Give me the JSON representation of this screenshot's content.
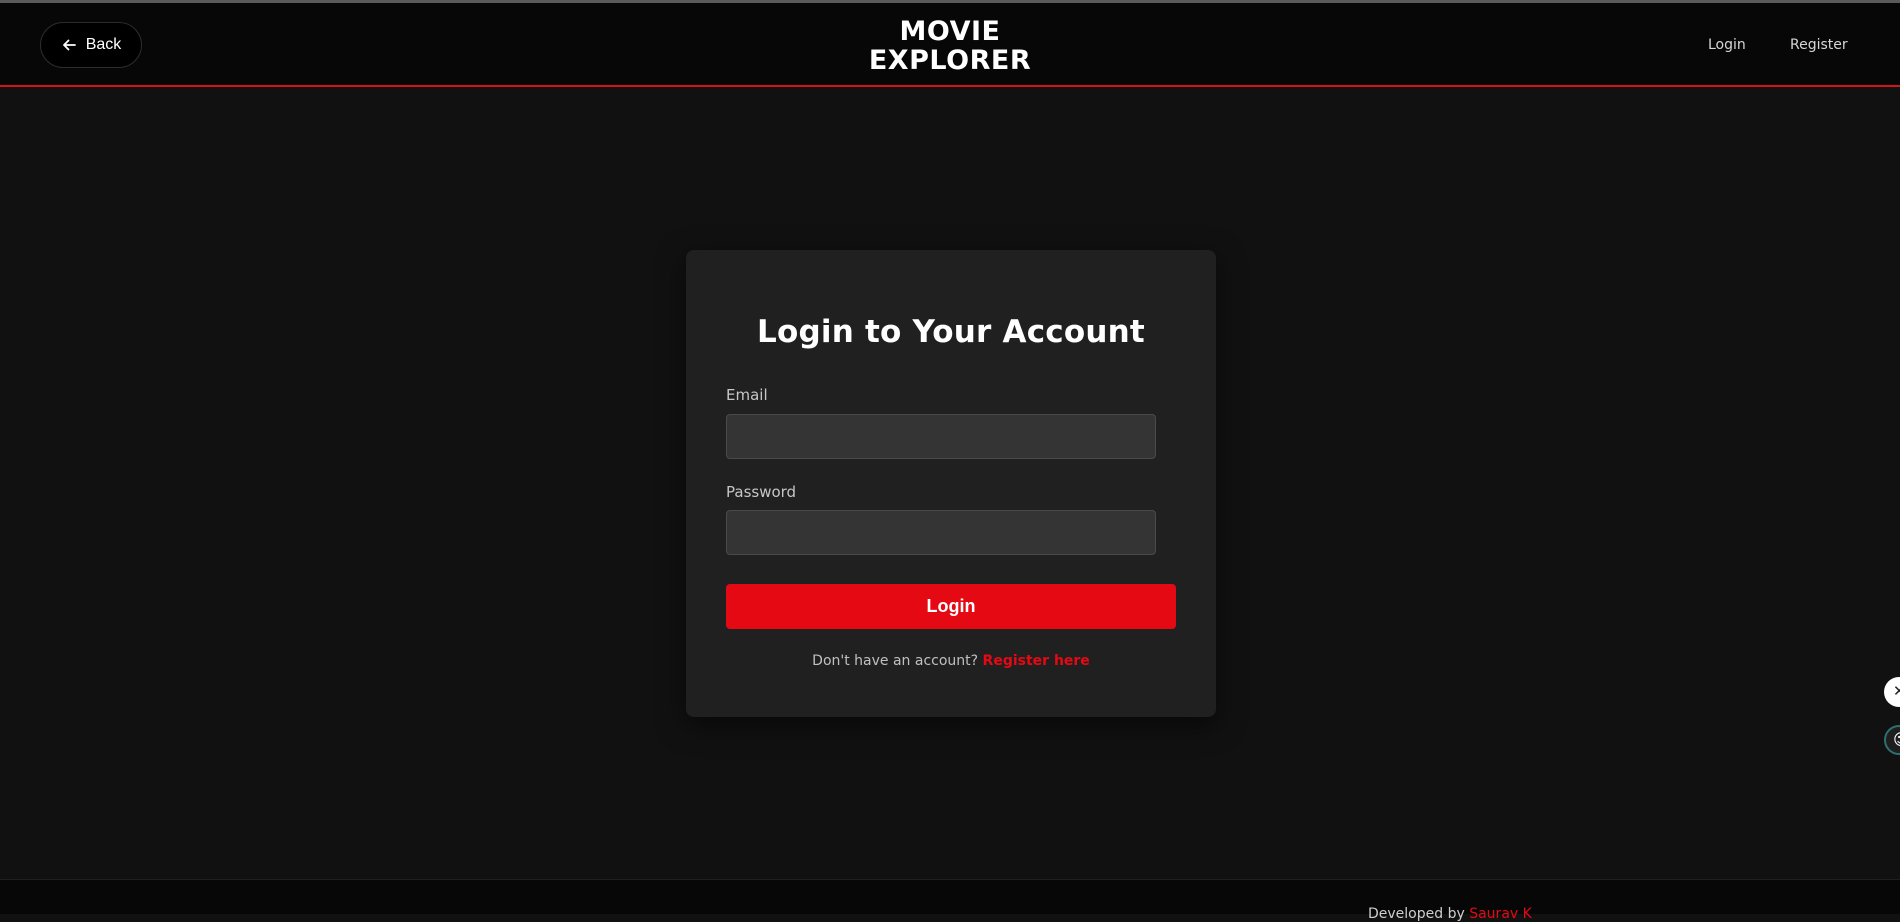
{
  "header": {
    "back_label": "Back",
    "logo_line1": "MOVIE",
    "logo_line2": "EXPLORER",
    "nav": {
      "login": "Login",
      "register": "Register"
    }
  },
  "login_form": {
    "title": "Login to Your Account",
    "email_label": "Email",
    "email_value": "",
    "password_label": "Password",
    "password_value": "",
    "submit_label": "Login",
    "register_prompt": "Don't have an account?",
    "register_link": "Register here"
  },
  "footer": {
    "text": "Developed by",
    "author": "Saurav K"
  },
  "side_widgets": {
    "close_icon": "close-icon",
    "assistant_icon": "assistant-bot-icon"
  },
  "colors": {
    "accent": "#e50914",
    "background": "#111111",
    "header_background": "#070707",
    "card_background": "#202020"
  }
}
